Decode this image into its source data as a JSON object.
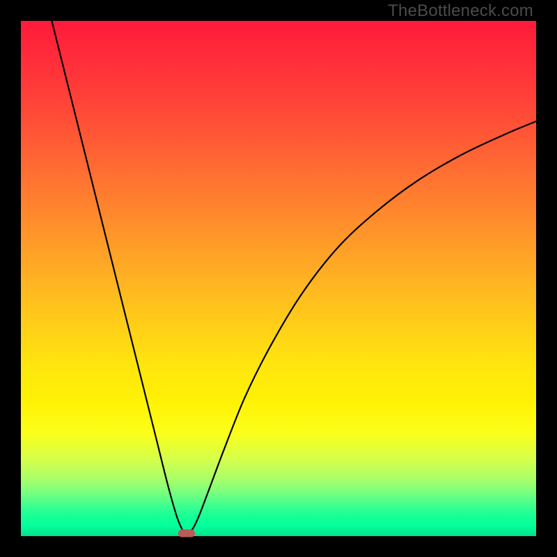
{
  "watermark": "TheBottleneck.com",
  "chart_data": {
    "type": "line",
    "title": "",
    "xlabel": "",
    "ylabel": "",
    "xlim": [
      0,
      100
    ],
    "ylim": [
      0,
      100
    ],
    "grid": false,
    "series": [
      {
        "name": "curve",
        "x": [
          6.0,
          9.0,
          12.5,
          16.0,
          19.5,
          23.0,
          26.0,
          28.5,
          30.2,
          31.2,
          31.8,
          32.5,
          33.4,
          34.6,
          36.5,
          39.5,
          43.5,
          48.5,
          54.5,
          61.5,
          69.0,
          77.0,
          85.5,
          94.0,
          100.0
        ],
        "y": [
          100.0,
          88.0,
          74.0,
          60.0,
          46.0,
          32.0,
          20.0,
          10.0,
          4.0,
          1.5,
          0.6,
          0.6,
          1.5,
          4.0,
          9.0,
          17.0,
          27.0,
          37.0,
          47.0,
          56.0,
          63.0,
          69.0,
          74.0,
          78.0,
          80.5
        ]
      }
    ],
    "marker": {
      "x": 32.1,
      "y": 0.5
    },
    "background": "rainbow-gradient"
  }
}
